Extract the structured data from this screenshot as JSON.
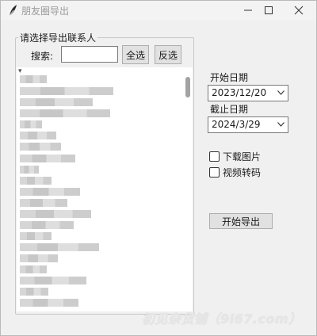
{
  "window": {
    "title": "朋友圈导出",
    "icon": "feather-icon"
  },
  "contacts": {
    "group_label": "请选择导出联系人",
    "search_label": "搜索:",
    "search_value": "",
    "select_all_label": "全选",
    "invert_label": "反选"
  },
  "dates": {
    "start_label": "开始日期",
    "start_value": "2023/12/20",
    "end_label": "截止日期",
    "end_value": "2024/3/29"
  },
  "options": {
    "download_images_label": "下载图片",
    "download_images_checked": false,
    "video_transcode_label": "视频转码",
    "video_transcode_checked": false
  },
  "actions": {
    "export_label": "开始导出"
  },
  "watermark": "初见杂货铺（9i67.com）"
}
